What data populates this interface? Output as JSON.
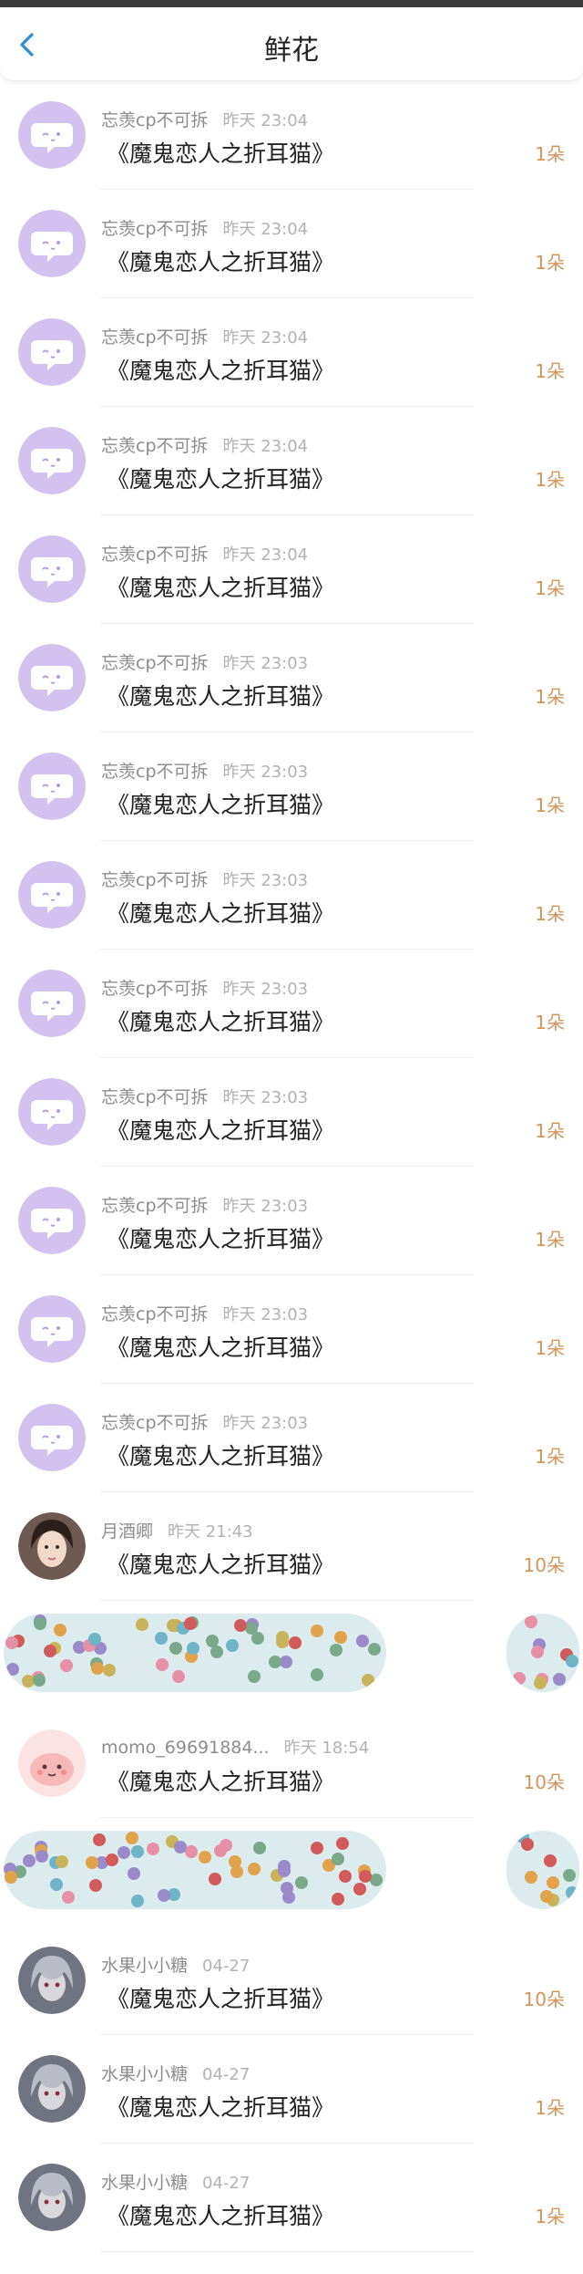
{
  "header": {
    "title": "鲜花",
    "back_icon": "chevron-left-icon",
    "accent": "#2a8cd8"
  },
  "colors": {
    "count": "#d4955a",
    "blob": "#dcebed"
  },
  "rows": [
    {
      "name": "忘羡cp不可拆",
      "time": "昨天 23:04",
      "book": "《魔鬼恋人之折耳猫》",
      "count": "1朵",
      "avatar": "default-chat-icon"
    },
    {
      "name": "忘羡cp不可拆",
      "time": "昨天 23:04",
      "book": "《魔鬼恋人之折耳猫》",
      "count": "1朵",
      "avatar": "default-chat-icon"
    },
    {
      "name": "忘羡cp不可拆",
      "time": "昨天 23:04",
      "book": "《魔鬼恋人之折耳猫》",
      "count": "1朵",
      "avatar": "default-chat-icon"
    },
    {
      "name": "忘羡cp不可拆",
      "time": "昨天 23:04",
      "book": "《魔鬼恋人之折耳猫》",
      "count": "1朵",
      "avatar": "default-chat-icon"
    },
    {
      "name": "忘羡cp不可拆",
      "time": "昨天 23:04",
      "book": "《魔鬼恋人之折耳猫》",
      "count": "1朵",
      "avatar": "default-chat-icon"
    },
    {
      "name": "忘羡cp不可拆",
      "time": "昨天 23:03",
      "book": "《魔鬼恋人之折耳猫》",
      "count": "1朵",
      "avatar": "default-chat-icon"
    },
    {
      "name": "忘羡cp不可拆",
      "time": "昨天 23:03",
      "book": "《魔鬼恋人之折耳猫》",
      "count": "1朵",
      "avatar": "default-chat-icon"
    },
    {
      "name": "忘羡cp不可拆",
      "time": "昨天 23:03",
      "book": "《魔鬼恋人之折耳猫》",
      "count": "1朵",
      "avatar": "default-chat-icon"
    },
    {
      "name": "忘羡cp不可拆",
      "time": "昨天 23:03",
      "book": "《魔鬼恋人之折耳猫》",
      "count": "1朵",
      "avatar": "default-chat-icon"
    },
    {
      "name": "忘羡cp不可拆",
      "time": "昨天 23:03",
      "book": "《魔鬼恋人之折耳猫》",
      "count": "1朵",
      "avatar": "default-chat-icon"
    },
    {
      "name": "忘羡cp不可拆",
      "time": "昨天 23:03",
      "book": "《魔鬼恋人之折耳猫》",
      "count": "1朵",
      "avatar": "default-chat-icon"
    },
    {
      "name": "忘羡cp不可拆",
      "time": "昨天 23:03",
      "book": "《魔鬼恋人之折耳猫》",
      "count": "1朵",
      "avatar": "default-chat-icon"
    },
    {
      "name": "忘羡cp不可拆",
      "time": "昨天 23:03",
      "book": "《魔鬼恋人之折耳猫》",
      "count": "1朵",
      "avatar": "default-chat-icon"
    },
    {
      "name": "月酒卿",
      "time": "昨天 21:43",
      "book": "《魔鬼恋人之折耳猫》",
      "count": "10朵",
      "avatar": "user-photo-icon"
    },
    {
      "blurred": true
    },
    {
      "name": "momo_69691884...",
      "time": "昨天 18:54",
      "book": "《魔鬼恋人之折耳猫》",
      "count": "10朵",
      "avatar": "pink-cartoon-icon"
    },
    {
      "blurred": true
    },
    {
      "name": "水果小小糖",
      "time": "04-27",
      "book": "《魔鬼恋人之折耳猫》",
      "count": "10朵",
      "avatar": "anime-girl-icon"
    },
    {
      "name": "水果小小糖",
      "time": "04-27",
      "book": "《魔鬼恋人之折耳猫》",
      "count": "1朵",
      "avatar": "anime-girl-icon"
    },
    {
      "name": "水果小小糖",
      "time": "04-27",
      "book": "《魔鬼恋人之折耳猫》",
      "count": "1朵",
      "avatar": "anime-girl-icon"
    }
  ]
}
